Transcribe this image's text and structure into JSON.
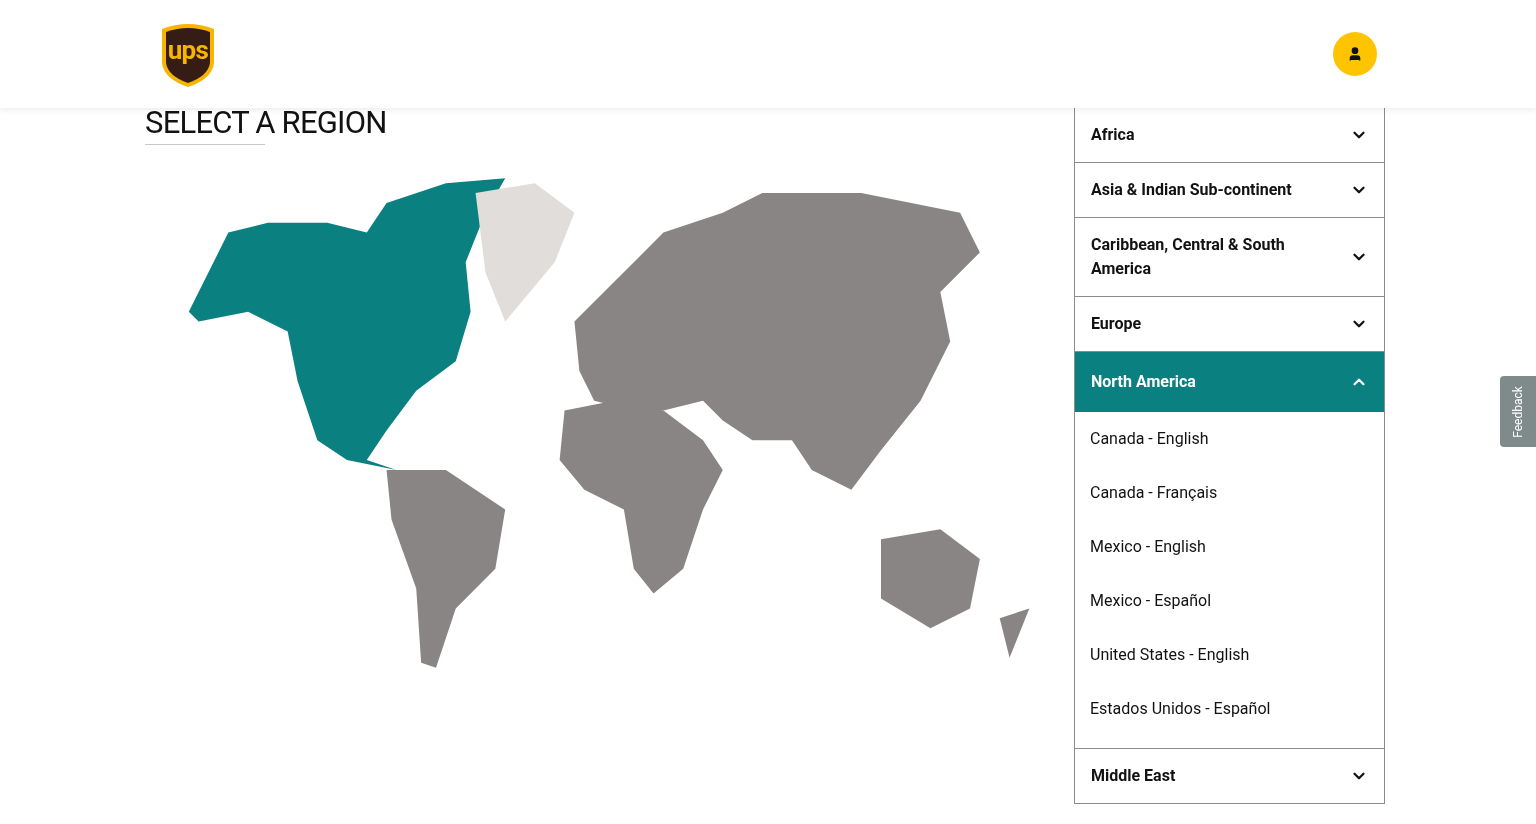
{
  "header": {
    "logo_text": "ups"
  },
  "heading": "SELECT A REGION",
  "regions": [
    {
      "name": "Africa",
      "expanded": false
    },
    {
      "name": "Asia & Indian Sub-continent",
      "expanded": false
    },
    {
      "name": "Caribbean, Central & South America",
      "expanded": false
    },
    {
      "name": "Europe",
      "expanded": false
    },
    {
      "name": "North America",
      "expanded": true,
      "links": [
        "Canada - English",
        "Canada - Français",
        "Mexico - English",
        "Mexico - Español",
        "United States - English",
        "Estados Unidos - Español"
      ]
    },
    {
      "name": "Middle East",
      "expanded": false
    }
  ],
  "feedback_tab": "Feedback"
}
